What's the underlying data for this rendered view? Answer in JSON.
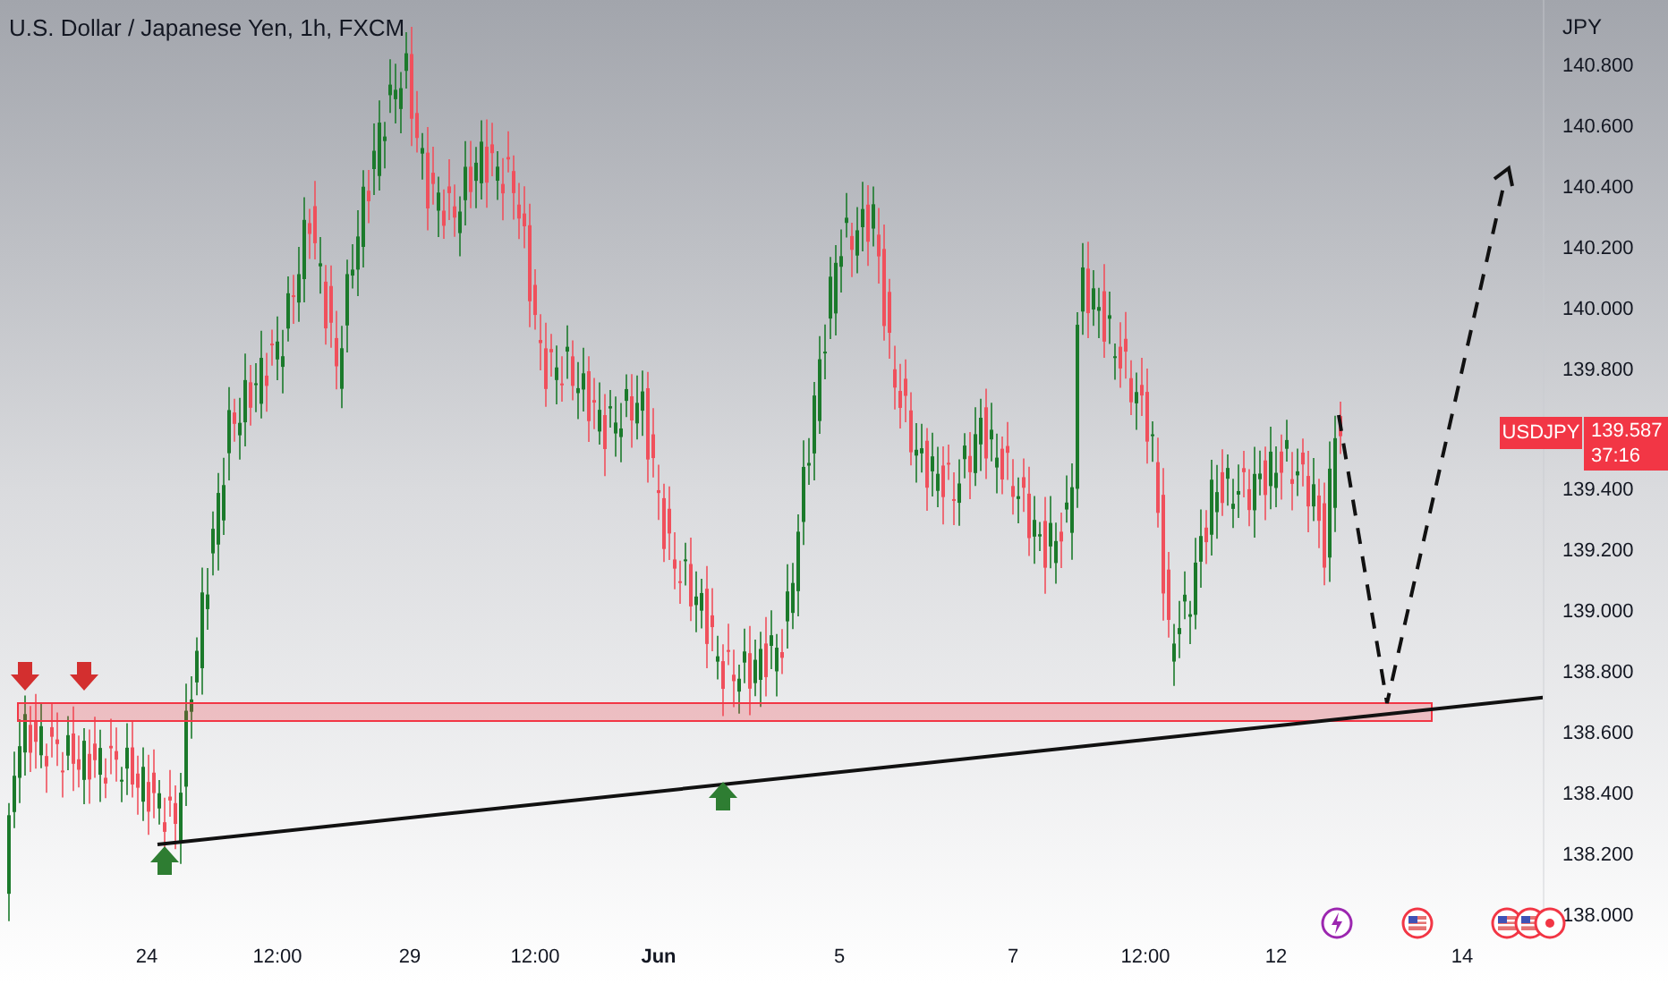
{
  "title": "U.S. Dollar / Japanese Yen, 1h, FXCM",
  "price_axis": {
    "currency": "JPY",
    "ticks": [
      "140.800",
      "140.600",
      "140.400",
      "140.200",
      "140.000",
      "139.800",
      "139.400",
      "139.200",
      "139.000",
      "138.800",
      "138.600",
      "138.400",
      "138.200",
      "138.000"
    ]
  },
  "symbol_tag": "USDJPY",
  "price_tag": {
    "price": "139.587",
    "countdown": "37:16"
  },
  "time_axis": [
    {
      "label": "24",
      "kind": "day"
    },
    {
      "label": "12:00",
      "kind": "hour"
    },
    {
      "label": "29",
      "kind": "day"
    },
    {
      "label": "12:00",
      "kind": "hour"
    },
    {
      "label": "Jun",
      "kind": "month"
    },
    {
      "label": "5",
      "kind": "day"
    },
    {
      "label": "7",
      "kind": "day"
    },
    {
      "label": "12:00",
      "kind": "hour"
    },
    {
      "label": "12",
      "kind": "day"
    },
    {
      "label": "14",
      "kind": "day"
    }
  ],
  "events": [
    {
      "kind": "lightning"
    },
    {
      "kind": "flag"
    },
    {
      "kind": "flag"
    },
    {
      "kind": "flag"
    },
    {
      "kind": "dot"
    }
  ]
}
